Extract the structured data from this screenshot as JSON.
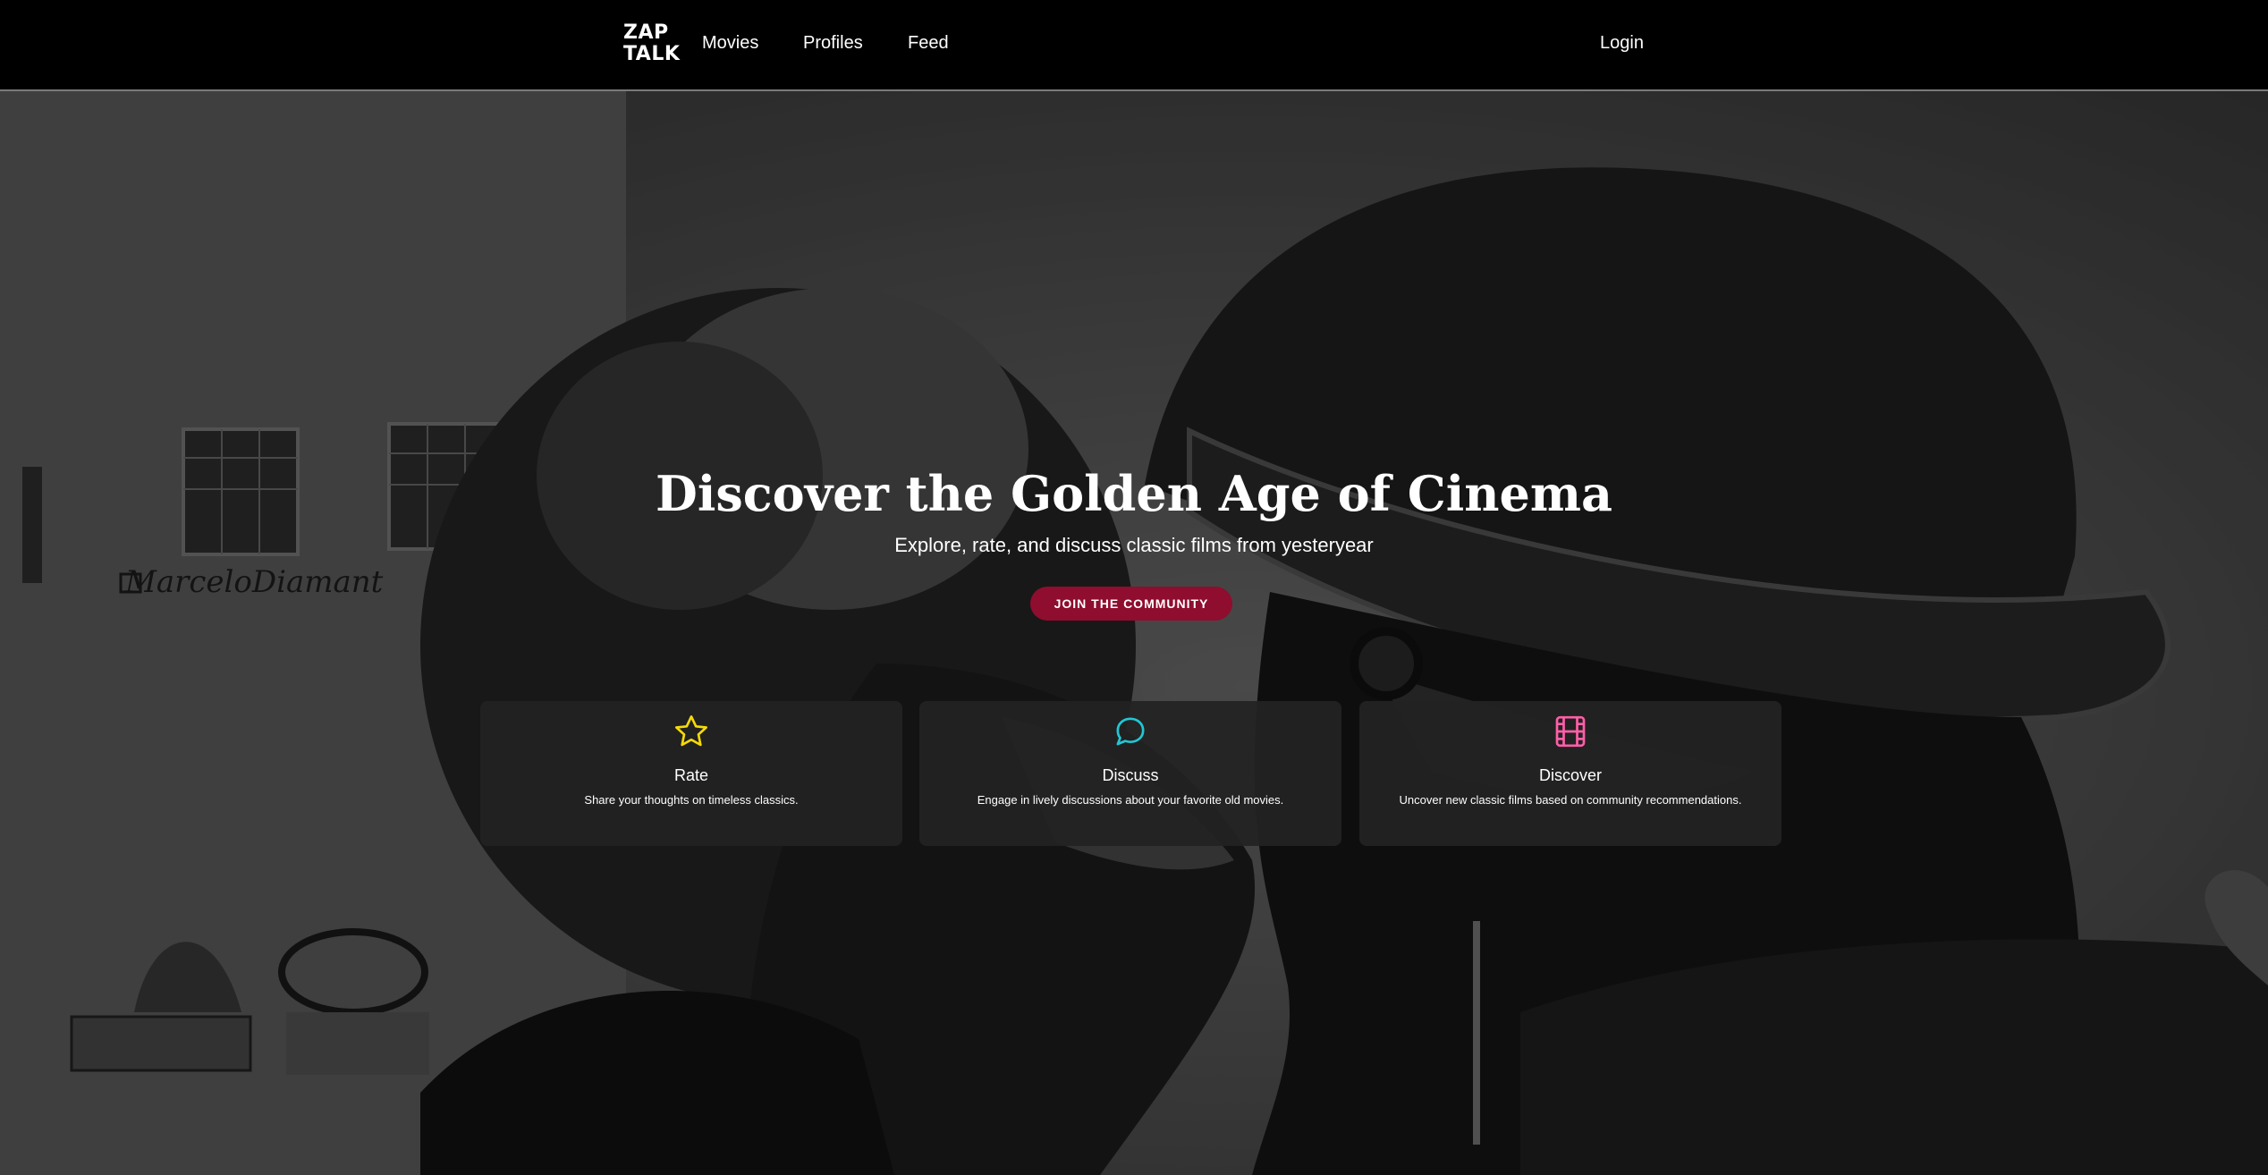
{
  "navbar": {
    "logo_line1": "ZAP",
    "logo_line2": "TALK",
    "links": [
      {
        "label": "Movies"
      },
      {
        "label": "Profiles"
      },
      {
        "label": "Feed"
      }
    ],
    "login_label": "Login"
  },
  "hero": {
    "title": "Discover the Golden Age of Cinema",
    "subtitle": "Explore, rate, and discuss classic films from yesteryear",
    "cta_label": "JOIN THE COMMUNITY",
    "background_text": "MarceloDiamant"
  },
  "features": [
    {
      "icon": "star-icon",
      "title": "Rate",
      "text": "Share your thoughts on timeless classics.",
      "color": "#f5d90a"
    },
    {
      "icon": "chat-bubble-icon",
      "title": "Discuss",
      "text": "Engage in lively discussions about your favorite old movies.",
      "color": "#22c7d4"
    },
    {
      "icon": "film-icon",
      "title": "Discover",
      "text": "Uncover new classic films based on community recommendations.",
      "color": "#ff5fa8"
    }
  ],
  "colors": {
    "cta": "#8f0d2e",
    "nav_background": "#000000"
  }
}
